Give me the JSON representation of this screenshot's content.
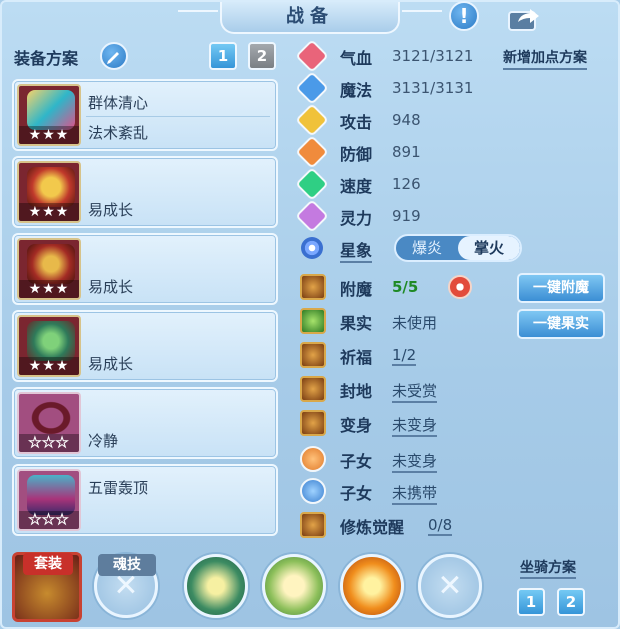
{
  "title": "战备",
  "equip_plan_label": "装备方案",
  "plan_tabs": [
    "1",
    "2"
  ],
  "equipment": [
    {
      "line1": "群体清心",
      "line2": "法术紊乱",
      "stars": "★★★",
      "filled": true
    },
    {
      "line1": "",
      "line2": "易成长",
      "stars": "★★★",
      "filled": true
    },
    {
      "line1": "",
      "line2": "易成长",
      "stars": "★★★",
      "filled": true
    },
    {
      "line1": "",
      "line2": "易成长",
      "stars": "★★★",
      "filled": true
    },
    {
      "line1": "",
      "line2": "冷静",
      "stars": "★★★",
      "filled": false
    },
    {
      "line1": "五雷轰顶",
      "line2": "",
      "stars": "★★★",
      "filled": false
    }
  ],
  "add_points_label": "新增加点方案",
  "attributes": [
    {
      "name": "气血",
      "value": "3121/3121",
      "color": "#e9647a"
    },
    {
      "name": "魔法",
      "value": "3131/3131",
      "color": "#4b9ae8"
    },
    {
      "name": "攻击",
      "value": "948",
      "color": "#f0c23a"
    },
    {
      "name": "防御",
      "value": "891",
      "color": "#f08b3c"
    },
    {
      "name": "速度",
      "value": "126",
      "color": "#2fcf84"
    },
    {
      "name": "灵力",
      "value": "919",
      "color": "#c47ae0"
    }
  ],
  "star_sign": {
    "name": "星象",
    "options": [
      "爆炎",
      "掌火"
    ],
    "selected": "掌火"
  },
  "features": [
    {
      "name": "附魔",
      "value": "5/5"
    },
    {
      "name": "果实",
      "value": "未使用"
    },
    {
      "name": "祈福",
      "value": "1/2"
    },
    {
      "name": "封地",
      "value": "未受赏"
    },
    {
      "name": "变身",
      "value": "未变身"
    },
    {
      "name": "子女",
      "value": "未变身"
    },
    {
      "name": "子女",
      "value": "未携带"
    },
    {
      "name": "修炼觉醒",
      "value": "0/8"
    }
  ],
  "buttons": {
    "enchant_all": "一键附魔",
    "fruit_all": "一键果实"
  },
  "bottom": {
    "suit_label": "套装",
    "soul_label": "魂技",
    "mount_plan_label": "坐骑方案",
    "mount_tabs": [
      "1",
      "2"
    ]
  }
}
